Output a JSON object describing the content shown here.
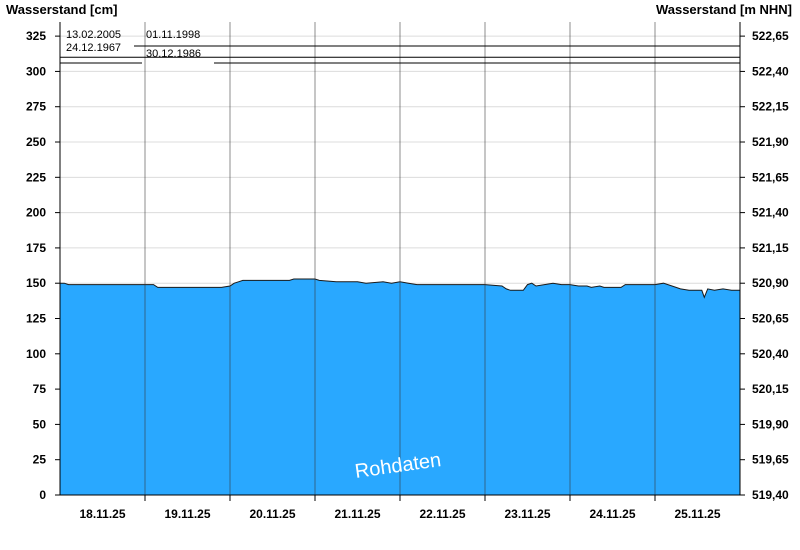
{
  "chart_data": {
    "type": "area",
    "title": "",
    "ylabel_left": "Wasserstand [cm]",
    "ylabel_right": "Wasserstand [m NHN]",
    "ylim": [
      0,
      335
    ],
    "y_ticks": [
      0,
      25,
      50,
      75,
      100,
      125,
      150,
      175,
      200,
      225,
      250,
      275,
      300,
      325
    ],
    "right_ticks": [
      {
        "value": 0,
        "label": "519,40"
      },
      {
        "value": 25,
        "label": "519,65"
      },
      {
        "value": 50,
        "label": "519,90"
      },
      {
        "value": 75,
        "label": "520,15"
      },
      {
        "value": 100,
        "label": "520,40"
      },
      {
        "value": 125,
        "label": "520,65"
      },
      {
        "value": 150,
        "label": "520,90"
      },
      {
        "value": 175,
        "label": "521,15"
      },
      {
        "value": 200,
        "label": "521,40"
      },
      {
        "value": 225,
        "label": "521,65"
      },
      {
        "value": 250,
        "label": "521,90"
      },
      {
        "value": 275,
        "label": "522,15"
      },
      {
        "value": 300,
        "label": "522,40"
      },
      {
        "value": 325,
        "label": "522,65"
      }
    ],
    "x_range": [
      0,
      8
    ],
    "x_day_boundaries": [
      1,
      2,
      3,
      4,
      5,
      6,
      7
    ],
    "x_labels": [
      {
        "x": 0.5,
        "label": "18.11.25"
      },
      {
        "x": 1.5,
        "label": "19.11.25"
      },
      {
        "x": 2.5,
        "label": "20.11.25"
      },
      {
        "x": 3.5,
        "label": "21.11.25"
      },
      {
        "x": 4.5,
        "label": "22.11.25"
      },
      {
        "x": 5.5,
        "label": "23.11.25"
      },
      {
        "x": 6.5,
        "label": "24.11.25"
      },
      {
        "x": 7.5,
        "label": "25.11.25"
      }
    ],
    "reference_lines": [
      {
        "value": 318,
        "label": "13.02.2005"
      },
      {
        "value": 318,
        "label": "01.11.1998"
      },
      {
        "value": 310,
        "label": "24.12.1967"
      },
      {
        "value": 306,
        "label": "30.12.1986"
      }
    ],
    "series": [
      {
        "color": "#29a8ff",
        "points": [
          [
            0.0,
            150
          ],
          [
            0.05,
            150
          ],
          [
            0.1,
            149
          ],
          [
            0.35,
            149
          ],
          [
            0.65,
            149
          ],
          [
            1.0,
            149
          ],
          [
            1.1,
            149
          ],
          [
            1.15,
            147
          ],
          [
            1.5,
            147
          ],
          [
            1.9,
            147
          ],
          [
            2.0,
            148
          ],
          [
            2.05,
            150
          ],
          [
            2.1,
            151
          ],
          [
            2.15,
            152
          ],
          [
            2.5,
            152
          ],
          [
            2.7,
            152
          ],
          [
            2.75,
            153
          ],
          [
            3.0,
            153
          ],
          [
            3.05,
            152
          ],
          [
            3.25,
            151
          ],
          [
            3.5,
            151
          ],
          [
            3.6,
            150
          ],
          [
            3.8,
            151
          ],
          [
            3.9,
            150
          ],
          [
            4.0,
            151
          ],
          [
            4.1,
            150
          ],
          [
            4.2,
            149
          ],
          [
            4.5,
            149
          ],
          [
            4.8,
            149
          ],
          [
            5.0,
            149
          ],
          [
            5.2,
            148
          ],
          [
            5.25,
            146
          ],
          [
            5.3,
            145
          ],
          [
            5.45,
            145
          ],
          [
            5.5,
            149
          ],
          [
            5.55,
            150
          ],
          [
            5.6,
            148
          ],
          [
            5.7,
            149
          ],
          [
            5.8,
            150
          ],
          [
            5.9,
            149
          ],
          [
            6.0,
            149
          ],
          [
            6.1,
            148
          ],
          [
            6.2,
            148
          ],
          [
            6.25,
            147
          ],
          [
            6.35,
            148
          ],
          [
            6.4,
            147
          ],
          [
            6.5,
            147
          ],
          [
            6.6,
            147
          ],
          [
            6.65,
            149
          ],
          [
            7.0,
            149
          ],
          [
            7.1,
            150
          ],
          [
            7.2,
            148
          ],
          [
            7.3,
            146
          ],
          [
            7.4,
            145
          ],
          [
            7.55,
            145
          ],
          [
            7.58,
            140
          ],
          [
            7.62,
            146
          ],
          [
            7.7,
            145
          ],
          [
            7.8,
            146
          ],
          [
            7.9,
            145
          ],
          [
            8.0,
            145
          ]
        ]
      }
    ],
    "watermark": "Rohdaten",
    "grid": true
  }
}
